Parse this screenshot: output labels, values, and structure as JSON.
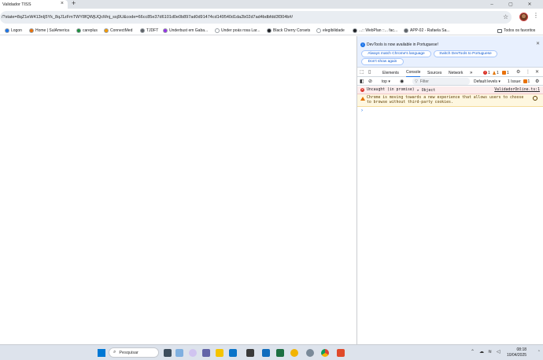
{
  "window": {
    "tab_title": "Validador TISS",
    "tab_close": "×",
    "new_tab": "+",
    "minimize": "–",
    "maximize": "▢",
    "close": "✕"
  },
  "address": {
    "url": "/?state=8qZ1eW413nIj5Yk_8qJ1zFmTWY8fQWjUQcMnj_ssj9U&code=66cc85e37d6101d0e0b897ad0d91474cd149540d1da2b02d7ad4bdbfdd3f304b#/"
  },
  "bookmarks": [
    {
      "label": "Logon",
      "color": "#1a73e8"
    },
    {
      "label": "Home | SulAmerica",
      "color": "#e8710a"
    },
    {
      "label": "careplus",
      "color": "#1e8e3e"
    },
    {
      "label": "ConnectMed",
      "color": "#f29900"
    },
    {
      "label": "TJDFT",
      "color": "#5f6368"
    },
    {
      "label": "Underbust em Gaba...",
      "color": "#9334e6"
    },
    {
      "label": "Under poás rosa Lar...",
      "color": "#ffffff"
    },
    {
      "label": "Black Cherry Corsets",
      "color": "#202124"
    },
    {
      "label": "elegibilidade",
      "color": "#ffffff"
    },
    {
      "label": "...:: WebPlan ::... fac...",
      "color": "#202124"
    },
    {
      "label": "APP-02 - Rafaela Sa...",
      "color": "#5f6368"
    }
  ],
  "bookmarks_all": "Todos os favoritos",
  "devtools": {
    "info_text": "DevTools is now available in Portuguese!",
    "btn_match": "Always match Chrome's language",
    "btn_switch": "Switch DevTools to Portuguese",
    "btn_dont": "Don't show again",
    "tabs": [
      "Elements",
      "Console",
      "Sources",
      "Network"
    ],
    "more_tabs": "»",
    "error_count": "1",
    "warn_count": "1",
    "issue_count": "1",
    "context": "top ▾",
    "filter_placeholder": "Filter",
    "levels": "Default levels ▾",
    "issues_label": "1 Issue:",
    "issues_count": "1",
    "error_msg": "Uncaught (in promise)",
    "error_obj": "▸ Object",
    "error_src": "ValidadorOnline.ts:1",
    "warn_line1": "Chrome is moving towards a new experience that allows users to choose",
    "warn_line2": "to browse without third-party cookies.",
    "prompt": "›",
    "colors": {
      "accent": "#1a73e8",
      "error": "#d93025",
      "warning": "#e37400"
    }
  },
  "taskbar": {
    "search_label": "Pesquisar",
    "time": "08:18",
    "date": "10/04/2025"
  }
}
